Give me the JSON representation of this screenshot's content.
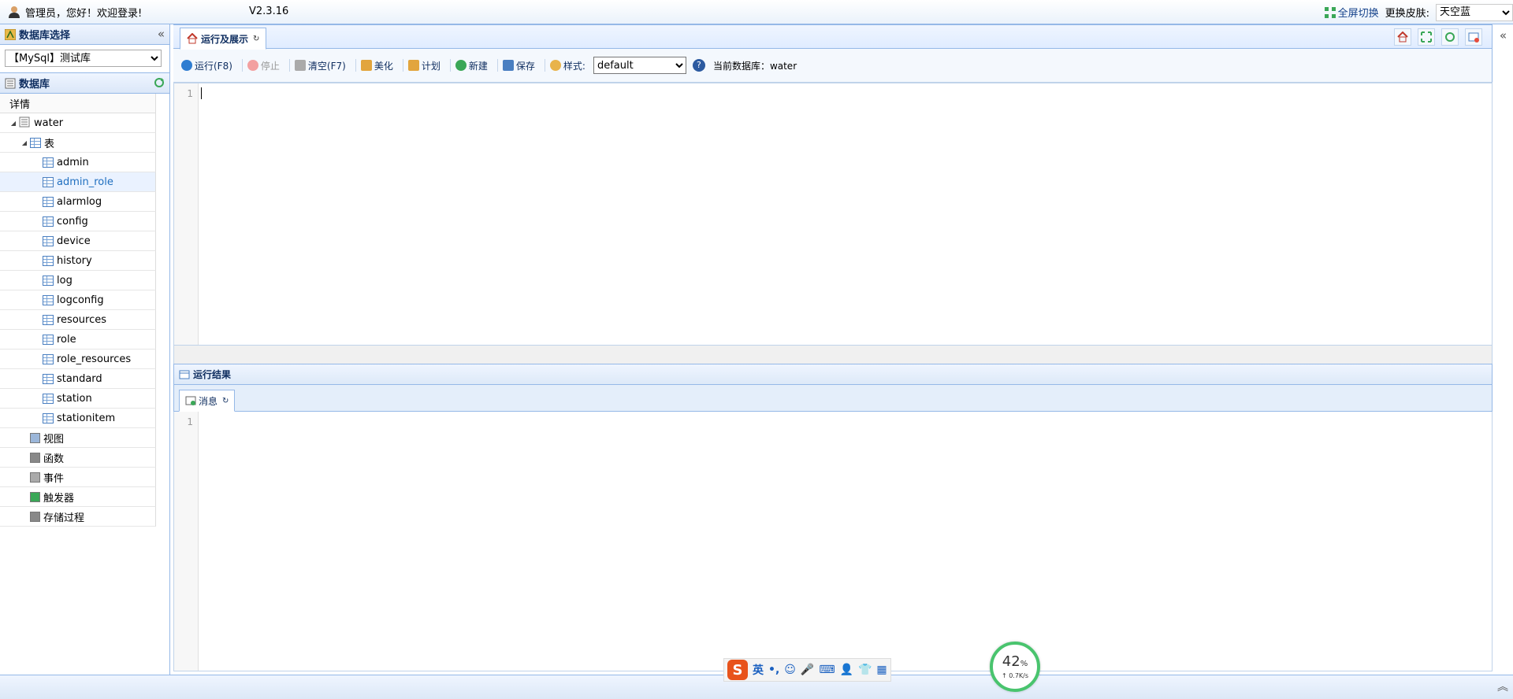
{
  "topbar": {
    "user_text": "管理员，您好！欢迎登录!",
    "version": "V2.3.16",
    "fullscreen_label": "全屏切换",
    "skin_label": "更换皮肤:",
    "skin_value": "天空蓝"
  },
  "sidebar": {
    "db_select_title": "数据库选择",
    "db_select_value": "【MySql】测试库",
    "db_panel_title": "数据库",
    "tree_header": "详情",
    "root": "water",
    "tables_node": "表",
    "tables": [
      "admin",
      "admin_role",
      "alarmlog",
      "config",
      "device",
      "history",
      "log",
      "logconfig",
      "resources",
      "role",
      "role_resources",
      "standard",
      "station",
      "stationitem"
    ],
    "selected_table": "admin_role",
    "other_nodes": [
      "视图",
      "函数",
      "事件",
      "触发器",
      "存储过程"
    ]
  },
  "main": {
    "tab_label": "运行及展示",
    "toolbar": {
      "run": "运行(F8)",
      "stop": "停止",
      "clear": "清空(F7)",
      "beautify": "美化",
      "plan": "计划",
      "new": "新建",
      "save": "保存",
      "style_label": "样式:",
      "style_value": "default",
      "current_db": "当前数据库：water"
    },
    "editor_line": "1",
    "result_title": "运行结果",
    "result_tab": "消息",
    "output_line": "1"
  },
  "overlay": {
    "ime_lang": "英",
    "ime_punct": "•,",
    "speed_pct": "42",
    "speed_unit": "%",
    "speed_rate": "↑ 0.7K/s"
  },
  "colors": {
    "accent": "#95b8e7",
    "header_text": "#0e2d5f",
    "selected_bg": "#eaf2ff"
  }
}
